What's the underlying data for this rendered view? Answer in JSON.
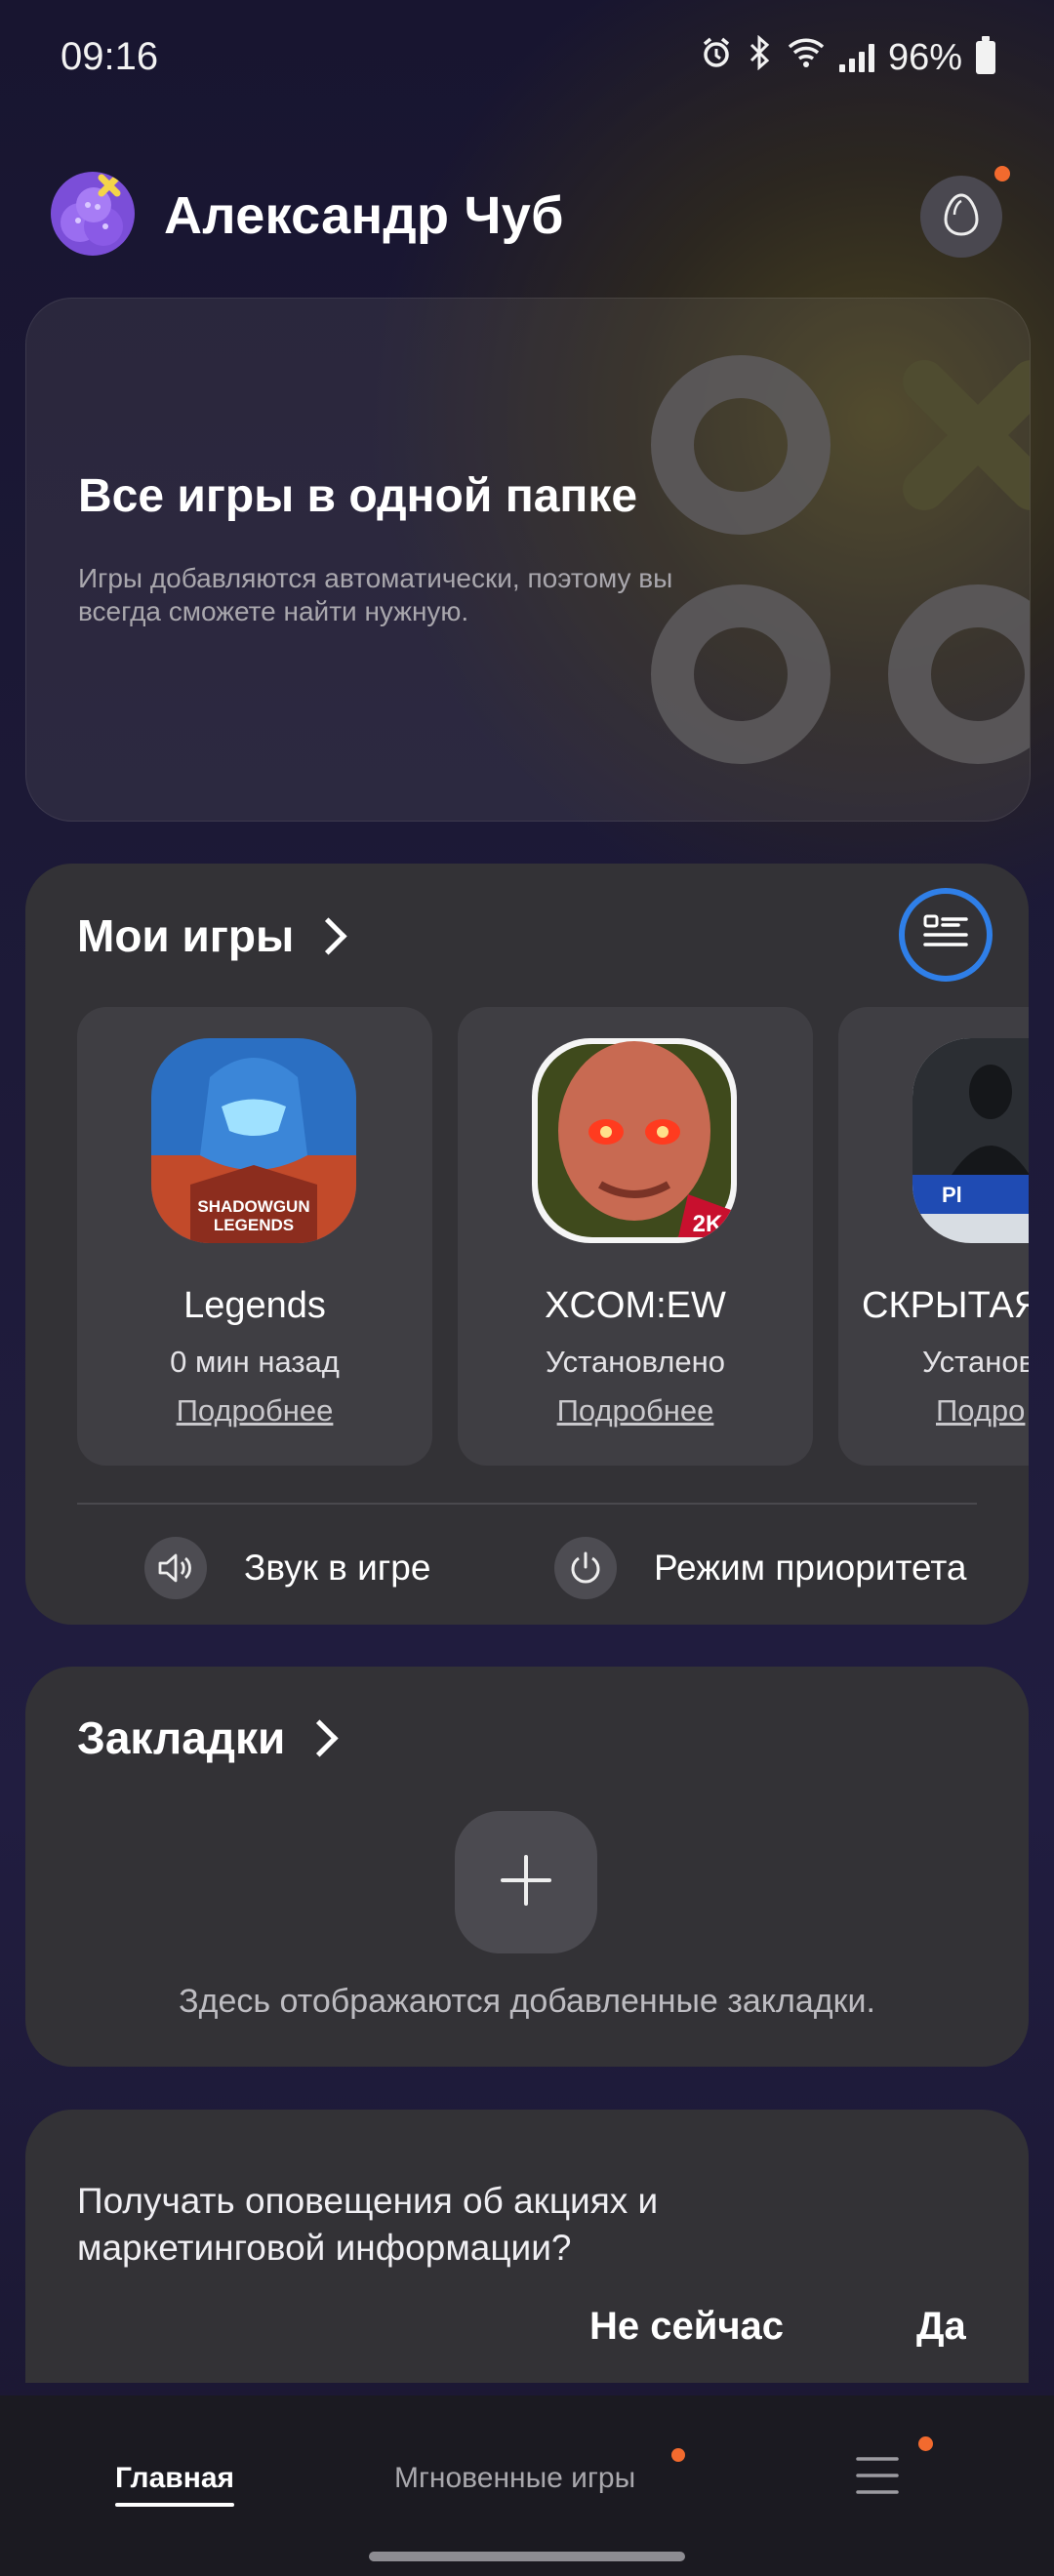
{
  "status_bar": {
    "time": "09:16",
    "battery": "96%"
  },
  "header": {
    "profile_name": "Александр Чуб"
  },
  "banner": {
    "title": "Все игры в одной папке",
    "subtitle": "Игры добавляются автоматически, поэтому вы всегда сможете найти нужную."
  },
  "my_games": {
    "title": "Мои игры",
    "games": [
      {
        "name": "Legends",
        "status": "0 мин назад",
        "link": "Подробнее"
      },
      {
        "name": "XCOM:EW",
        "status": "Установлено",
        "link": "Подробнее"
      },
      {
        "name": "СКРЫТАЯ",
        "status": "Установл",
        "link": "Подро"
      }
    ],
    "quick_actions": {
      "sound": "Звук в игре",
      "priority": "Режим приоритета"
    }
  },
  "bookmarks": {
    "title": "Закладки",
    "empty_text": "Здесь отображаются добавленные закладки."
  },
  "marketing": {
    "text": "Получать оповещения об акциях и маркетинговой информации?",
    "not_now": "Не сейчас",
    "yes": "Да"
  },
  "bottom_nav": {
    "home": "Главная",
    "instant": "Мгновенные игры"
  },
  "colors": {
    "accent_blue": "#2f7fe8",
    "notification_dot": "#f26a2e"
  }
}
